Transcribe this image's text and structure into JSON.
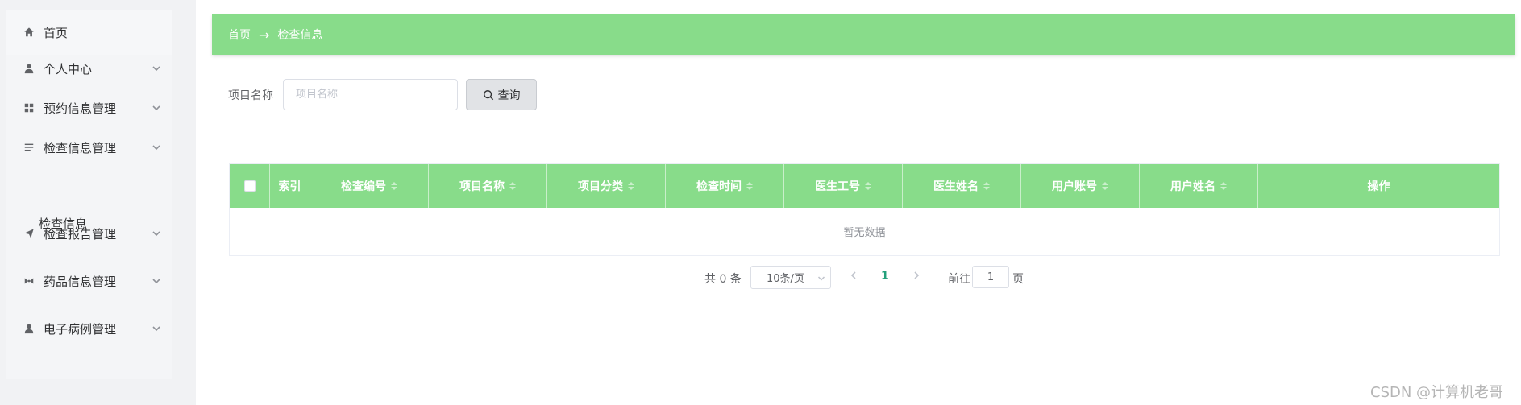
{
  "sidebar": {
    "items": [
      {
        "label": "首页",
        "icon": "home-icon"
      },
      {
        "label": "个人中心",
        "icon": "user-icon"
      },
      {
        "label": "预约信息管理",
        "icon": "grid-icon"
      },
      {
        "label": "检查信息管理",
        "icon": "list-icon"
      },
      {
        "label": "检查报告管理",
        "icon": "send-icon"
      },
      {
        "label": "药品信息管理",
        "icon": "pill-icon"
      },
      {
        "label": "电子病例管理",
        "icon": "user-icon"
      }
    ],
    "subitem": "检查信息"
  },
  "breadcrumb": {
    "home": "首页",
    "separator": "→",
    "current": "检查信息"
  },
  "search": {
    "label": "项目名称",
    "placeholder": "项目名称",
    "button": "查询"
  },
  "table": {
    "columns": [
      "索引",
      "检查编号",
      "项目名称",
      "项目分类",
      "检查时间",
      "医生工号",
      "医生姓名",
      "用户账号",
      "用户姓名",
      "操作"
    ],
    "empty_text": "暂无数据"
  },
  "pagination": {
    "total": "共 0 条",
    "page_size": "10条/页",
    "current_page": "1",
    "goto_label": "前往",
    "goto_value": "1",
    "page_suffix": "页"
  },
  "watermark": "CSDN @计算机老哥",
  "colors": {
    "header_green": "#88dc8a",
    "active_page": "#23a07b",
    "sidebar_bg": "#f1f2f4"
  }
}
